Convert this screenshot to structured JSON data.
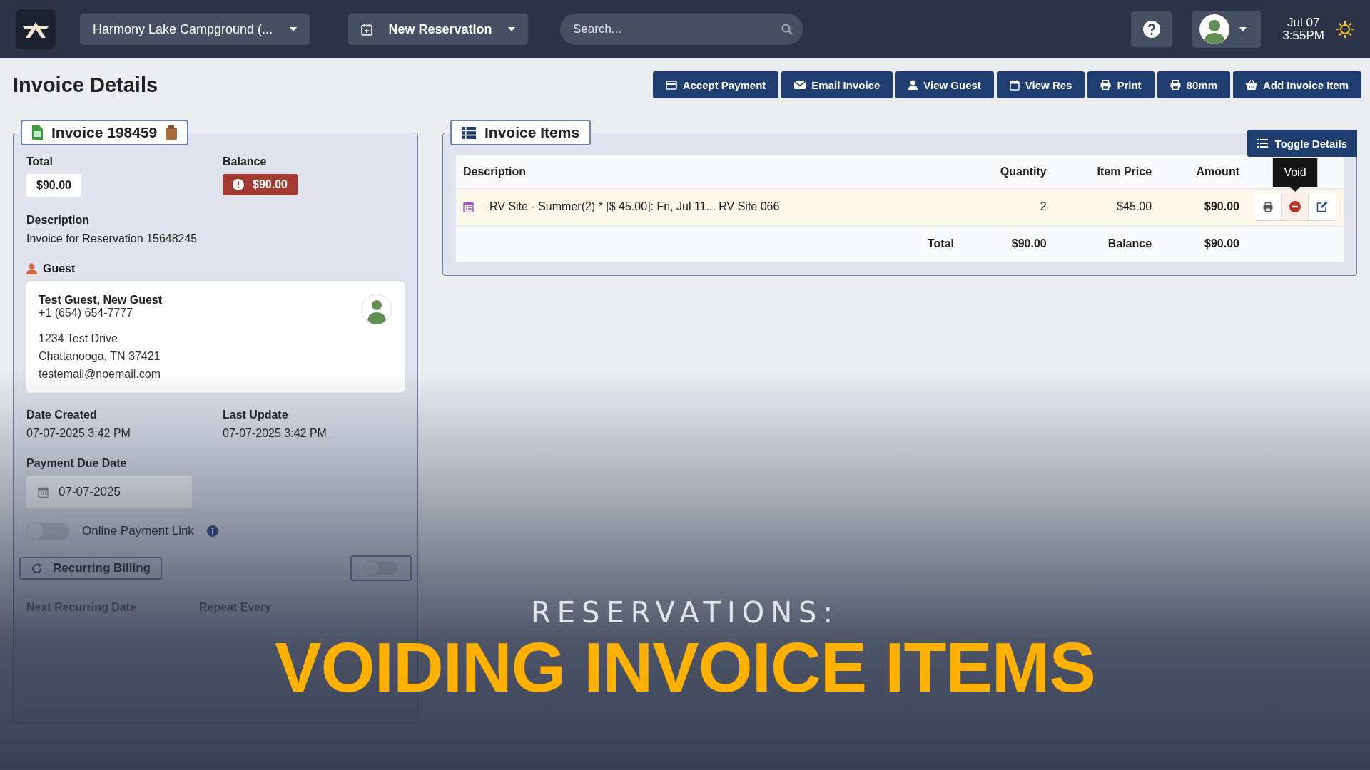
{
  "top_bar": {
    "campground": "Harmony Lake Campground (...",
    "new_reservation": "New Reservation",
    "search": {
      "placeholder": "Search..."
    },
    "date": "Jul 07",
    "time": "3:55PM"
  },
  "page_title": "Invoice Details",
  "actions": [
    {
      "label": "Accept Payment"
    },
    {
      "label": "Email Invoice"
    },
    {
      "label": "View Guest"
    },
    {
      "label": "View Res"
    },
    {
      "label": "Print"
    },
    {
      "label": "80mm"
    },
    {
      "label": "Add Invoice Item"
    }
  ],
  "invoice": {
    "title": "Invoice 198459",
    "total_label": "Total",
    "total": "$90.00",
    "balance_label": "Balance",
    "balance": "$90.00",
    "description_label": "Description",
    "description": "Invoice for Reservation 15648245",
    "guest_label": "Guest",
    "guest": {
      "name": "Test Guest, New Guest",
      "phone": "+1 (654) 654-7777",
      "address": [
        "1234 Test Drive",
        "Chattanooga, TN 37421"
      ],
      "email": "testemail@noemail.com"
    },
    "date_created_label": "Date Created",
    "date_created": "07-07-2025 3:42 PM",
    "last_update_label": "Last Update",
    "last_update": "07-07-2025 3:42 PM",
    "payment_due_label": "Payment Due Date",
    "payment_due": "07-07-2025",
    "online_payment": {
      "label": "Online Payment Link",
      "on": false
    },
    "recurring": {
      "title": "Recurring Billing",
      "on": false,
      "next_label": "Next Recurring Date",
      "repeat_label": "Repeat Every"
    }
  },
  "items": {
    "title": "Invoice Items",
    "toggle": "Toggle Details",
    "columns": [
      "Description",
      "Quantity",
      "Item Price",
      "Amount"
    ],
    "rows": [
      {
        "description": "RV Site - Summer(2) * [$ 45.00]: Fri, Jul 11... RV Site 066",
        "quantity": "2",
        "item_price": "$45.00",
        "amount": "$90.00"
      }
    ],
    "total_label": "Total",
    "total": "$90.00",
    "balance_label": "Balance",
    "balance": "$90.00",
    "tooltip": "Void"
  },
  "banner": {
    "kicker": "RESERVATIONS:",
    "title": "VOIDING INVOICE ITEMS"
  }
}
